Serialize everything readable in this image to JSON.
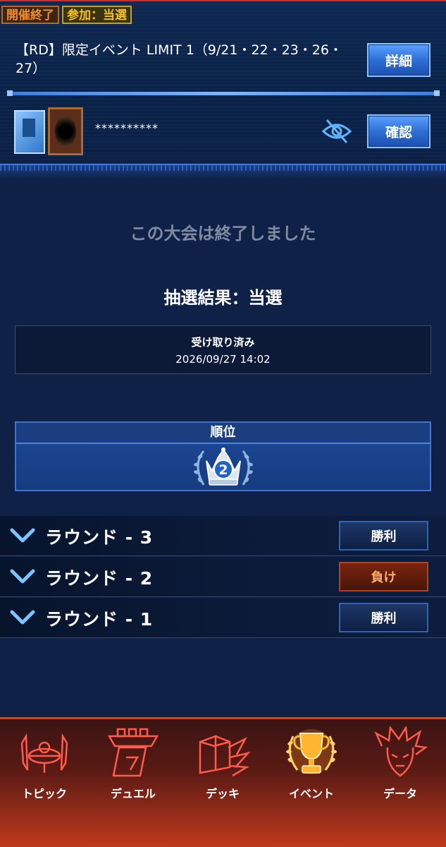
{
  "header": {
    "status_badge": "開催終了",
    "participation_badge": "参加：当選",
    "event_title": "【RD】限定イベント LIMIT 1（9/21・22・23・26・27）",
    "details_button": "詳細",
    "deck_code": "**********",
    "confirm_button": "確認"
  },
  "main": {
    "ended_message": "この大会は終了しました",
    "lottery_result": "抽選結果：当選",
    "received_label": "受け取り済み",
    "received_date": "2026/09/27 14:02",
    "rank_header": "順位",
    "rank_value": "2"
  },
  "rounds": [
    {
      "label": "ラウンド - 3",
      "result": "勝利",
      "outcome": "win"
    },
    {
      "label": "ラウンド - 2",
      "result": "負け",
      "outcome": "lose"
    },
    {
      "label": "ラウンド - 1",
      "result": "勝利",
      "outcome": "win"
    }
  ],
  "nav": {
    "topic": "トピック",
    "duel": "デュエル",
    "deck": "デッキ",
    "event": "イベント",
    "data": "データ",
    "active": "event"
  },
  "colors": {
    "win_button": "#1d3766",
    "lose_button": "#7a2410",
    "accent_blue": "#2f6fd6",
    "nav_red": "#c0391c",
    "nav_active_gold": "#ffb52e"
  }
}
